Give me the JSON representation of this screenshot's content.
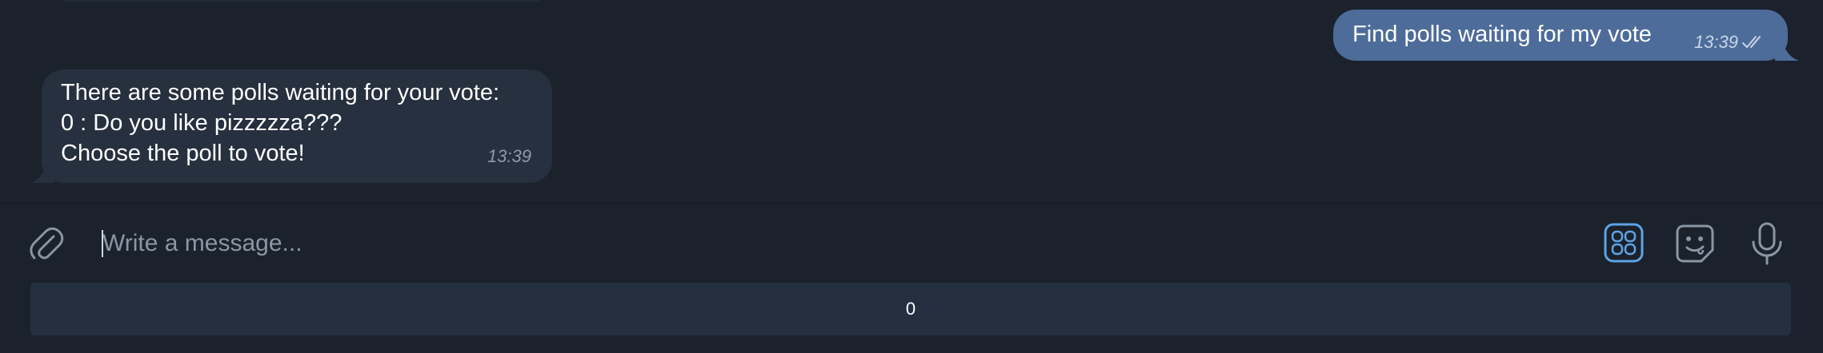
{
  "chat": {
    "outgoing": {
      "text": "Find polls waiting for my vote",
      "time": "13:39",
      "status_icon": "double-check-icon"
    },
    "incoming": {
      "lines": [
        "There are some polls waiting for your vote:",
        "0 : Do you like pizzzzza???",
        "Choose the poll to vote!"
      ],
      "time": "13:39"
    }
  },
  "composer": {
    "placeholder": "Write a message...",
    "value": "",
    "icons": {
      "attach": "paperclip-icon",
      "apps": "bot-commands-icon",
      "sticker": "sticker-icon",
      "mic": "microphone-icon"
    }
  },
  "keyboard": {
    "buttons": [
      "0"
    ]
  },
  "colors": {
    "background": "#1b222c",
    "outgoing_bubble": "#4d6c99",
    "incoming_bubble": "#26303e",
    "accent": "#5ea3e6",
    "keyboard_button": "#243040"
  }
}
